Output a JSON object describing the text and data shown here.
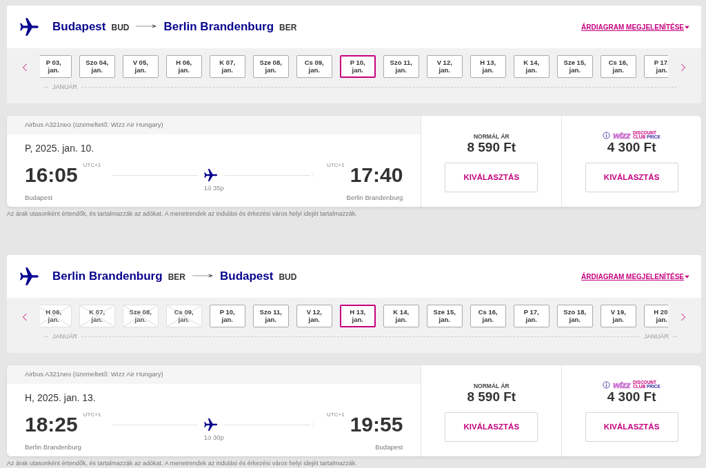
{
  "sections": [
    {
      "route": {
        "from_city": "Budapest",
        "from_code": "BUD",
        "to_city": "Berlin Brandenburg",
        "to_code": "BER"
      },
      "chart_link": "ÁRDIAGRAM MEGJELENÍTÉSE",
      "dates": [
        {
          "day": "P 03,",
          "month": "jan.",
          "selected": false,
          "disabled": false
        },
        {
          "day": "Szo 04,",
          "month": "jan.",
          "selected": false,
          "disabled": false
        },
        {
          "day": "V 05,",
          "month": "jan.",
          "selected": false,
          "disabled": false
        },
        {
          "day": "H 06,",
          "month": "jan.",
          "selected": false,
          "disabled": false
        },
        {
          "day": "K 07,",
          "month": "jan.",
          "selected": false,
          "disabled": false
        },
        {
          "day": "Sze 08,",
          "month": "jan.",
          "selected": false,
          "disabled": false
        },
        {
          "day": "Cs 09,",
          "month": "jan.",
          "selected": false,
          "disabled": false
        },
        {
          "day": "P 10,",
          "month": "jan.",
          "selected": true,
          "disabled": false
        },
        {
          "day": "Szo 11,",
          "month": "jan.",
          "selected": false,
          "disabled": false
        },
        {
          "day": "V 12,",
          "month": "jan.",
          "selected": false,
          "disabled": false
        },
        {
          "day": "H 13,",
          "month": "jan.",
          "selected": false,
          "disabled": false
        },
        {
          "day": "K 14,",
          "month": "jan.",
          "selected": false,
          "disabled": false
        },
        {
          "day": "Sze 15,",
          "month": "jan.",
          "selected": false,
          "disabled": false
        },
        {
          "day": "Cs 16,",
          "month": "jan.",
          "selected": false,
          "disabled": false
        },
        {
          "day": "P 17,",
          "month": "jan.",
          "selected": false,
          "disabled": false
        }
      ],
      "month_labels": [
        {
          "text": "JANUÁR",
          "kind": "start"
        }
      ],
      "flight": {
        "aircraft": "Airbus A321neo (üzemeltető: Wizz Air Hungary)",
        "date": "P, 2025. jan. 10.",
        "dep_time": "16:05",
        "dep_tz": "UTC+1",
        "dep_city": "Budapest",
        "duration": "1ó 35p",
        "arr_tz": "UTC+1",
        "arr_time": "17:40",
        "arr_city": "Berlin Brandenburg",
        "normal": {
          "label": "NORMÁL ÁR",
          "price": "8 590 Ft",
          "button": "KIVÁLASZTÁS"
        },
        "club": {
          "brand": "wizz",
          "line1": "DISCOUNT",
          "line2a": "CLUB",
          "line2b": "PRICE",
          "price": "4 300 Ft",
          "button": "KIVÁLASZTÁS"
        }
      },
      "note": "Az árak utasonként értendők, és tartalmazzák az adókat. A menetrendek az indulási és érkezési város helyi idejét tartalmazzák."
    },
    {
      "route": {
        "from_city": "Berlin Brandenburg",
        "from_code": "BER",
        "to_city": "Budapest",
        "to_code": "BUD"
      },
      "chart_link": "ÁRDIAGRAM MEGJELENÍTÉSE",
      "dates": [
        {
          "day": "H 06,",
          "month": "jan.",
          "selected": false,
          "disabled": true
        },
        {
          "day": "K 07,",
          "month": "jan.",
          "selected": false,
          "disabled": true
        },
        {
          "day": "Sze 08,",
          "month": "jan.",
          "selected": false,
          "disabled": true
        },
        {
          "day": "Cs 09,",
          "month": "jan.",
          "selected": false,
          "disabled": true
        },
        {
          "day": "P 10,",
          "month": "jan.",
          "selected": false,
          "disabled": false
        },
        {
          "day": "Szo 11,",
          "month": "jan.",
          "selected": false,
          "disabled": false
        },
        {
          "day": "V 12,",
          "month": "jan.",
          "selected": false,
          "disabled": false
        },
        {
          "day": "H 13,",
          "month": "jan.",
          "selected": true,
          "disabled": false
        },
        {
          "day": "K 14,",
          "month": "jan.",
          "selected": false,
          "disabled": false
        },
        {
          "day": "Sze 15,",
          "month": "jan.",
          "selected": false,
          "disabled": false
        },
        {
          "day": "Cs 16,",
          "month": "jan.",
          "selected": false,
          "disabled": false
        },
        {
          "day": "P 17,",
          "month": "jan.",
          "selected": false,
          "disabled": false
        },
        {
          "day": "Szo 18,",
          "month": "jan.",
          "selected": false,
          "disabled": false
        },
        {
          "day": "V 19,",
          "month": "jan.",
          "selected": false,
          "disabled": false
        },
        {
          "day": "H 20,",
          "month": "jan.",
          "selected": false,
          "disabled": false
        }
      ],
      "month_labels": [
        {
          "text": "JANUÁR",
          "kind": "start"
        },
        {
          "text": "JANUÁR",
          "kind": "end"
        }
      ],
      "flight": {
        "aircraft": "Airbus A321neo (üzemeltető: Wizz Air Hungary)",
        "date": "H, 2025. jan. 13.",
        "dep_time": "18:25",
        "dep_tz": "UTC+1",
        "dep_city": "Berlin Brandenburg",
        "duration": "1ó 30p",
        "arr_tz": "UTC+1",
        "arr_time": "19:55",
        "arr_city": "Budapest",
        "normal": {
          "label": "NORMÁL ÁR",
          "price": "8 590 Ft",
          "button": "KIVÁLASZTÁS"
        },
        "club": {
          "brand": "wizz",
          "line1": "DISCOUNT",
          "line2a": "CLUB",
          "line2b": "PRICE",
          "price": "4 300 Ft",
          "button": "KIVÁLASZTÁS"
        }
      },
      "note": "Az árak utasonként értendők, és tartalmazzák az adókat. A menetrendek az indulási és érkezési város helyi idejét tartalmazzák."
    }
  ]
}
